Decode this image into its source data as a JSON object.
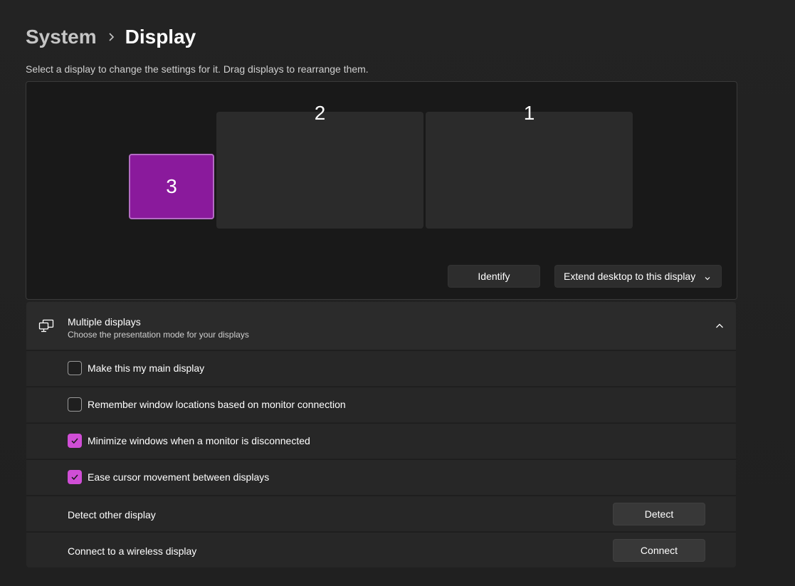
{
  "breadcrumb": {
    "parent": "System",
    "separator": "›",
    "current": "Display"
  },
  "subtitle": "Select a display to change the settings for it. Drag displays to rearrange them.",
  "arrangement": {
    "monitors": [
      {
        "label": "3",
        "selected": true
      },
      {
        "label": "2",
        "selected": false
      },
      {
        "label": "1",
        "selected": false
      }
    ],
    "identify_label": "Identify",
    "mode_select_value": "Extend desktop to this display"
  },
  "multiple_displays": {
    "title": "Multiple displays",
    "description": "Choose the presentation mode for your displays",
    "icon": "multiple-displays-icon",
    "options": [
      {
        "label": "Make this my main display",
        "checked": false
      },
      {
        "label": "Remember window locations based on monitor connection",
        "checked": false
      },
      {
        "label": "Minimize windows when a monitor is disconnected",
        "checked": true
      },
      {
        "label": "Ease cursor movement between displays",
        "checked": true
      }
    ],
    "detect": {
      "label": "Detect other display",
      "button": "Detect"
    },
    "connect": {
      "label": "Connect to a wireless display",
      "button": "Connect"
    }
  },
  "colors": {
    "accent": "#d04ed6",
    "selected_monitor": "#8a1a9c",
    "background": "#202020",
    "card": "#2b2b2b"
  }
}
